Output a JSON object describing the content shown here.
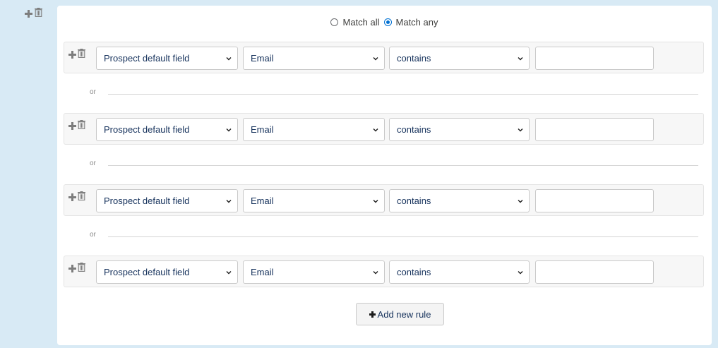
{
  "match": {
    "all_label": "Match all",
    "any_label": "Match any",
    "selected": "any"
  },
  "rules": [
    {
      "field_type": "Prospect default field",
      "field": "Email",
      "operator": "contains",
      "value": ""
    },
    {
      "field_type": "Prospect default field",
      "field": "Email",
      "operator": "contains",
      "value": ""
    },
    {
      "field_type": "Prospect default field",
      "field": "Email",
      "operator": "contains",
      "value": ""
    },
    {
      "field_type": "Prospect default field",
      "field": "Email",
      "operator": "contains",
      "value": ""
    }
  ],
  "separators": [
    "or",
    "or",
    "or"
  ],
  "add_rule_label": "Add new rule",
  "icons": {
    "add": "plus-icon",
    "delete": "trash-icon",
    "dropdown": "chevron-down-icon"
  },
  "colors": {
    "background": "#d8eaf5",
    "radio_accent": "#0070d2"
  }
}
